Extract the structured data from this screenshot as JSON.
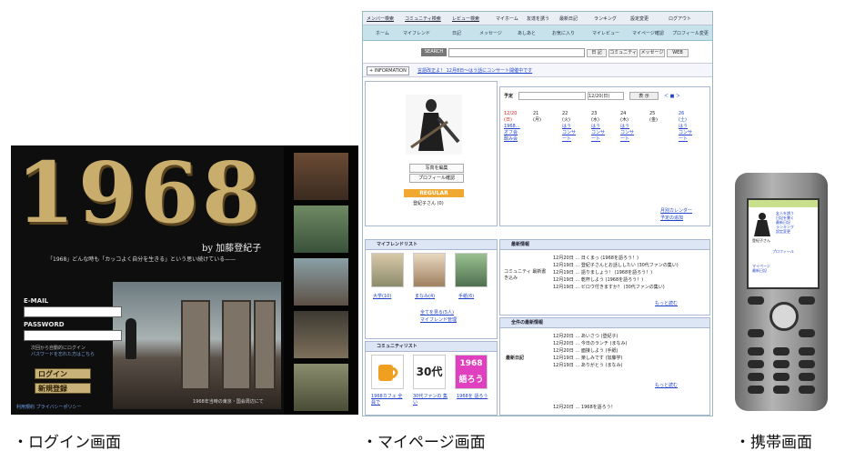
{
  "login_screen": {
    "logo_text": "1968",
    "author_credit": "by 加藤登紀子",
    "tagline": "「1968」どんな時も「カッコよく自分を生きる」という思い続けている——",
    "email_label": "E-MAIL",
    "password_label": "PASSWORD",
    "remember_hint": "次回から自動的にログイン",
    "forgot_link": "パスワードを忘れた方はこちら",
    "login_button": "ログイン",
    "register_button": "新規登録",
    "footer_link": "利用規約 プライバシーポリシー",
    "photo_caption": "1968年当時の東京・国会周辺にて"
  },
  "mypage_screen": {
    "topbar": [
      "メンバー検索",
      "コミュニティ検索",
      "レビュー検索",
      "マイホーム",
      "友達を誘う",
      "最新日記",
      "ランキング",
      "設定変更",
      "ログアウト"
    ],
    "nav": [
      "ホーム",
      "マイフレンド",
      "日記",
      "メッセージ",
      "あしあと",
      "お気に入り",
      "マイレビュー",
      "マイページ確認",
      "プロフィール変更"
    ],
    "search_button": "SEARCH",
    "search_options": [
      "日 記",
      "コミュニティ",
      "メッセージ",
      "WEB"
    ],
    "info_label": "+ INFORMATION",
    "info_text": "言語改正よ！ 12月8日〜はう話にコンサート開催中です",
    "profile_buttons": [
      "写真を編集",
      "プロフィール確認"
    ],
    "rank_badge": "REGULAR",
    "user_name": "登紀子さん (0)",
    "schedule": {
      "label": "予定",
      "date_select": "12/20(日)",
      "go_button": "表 示",
      "nav_links": "＜ ■ ＞",
      "days": [
        {
          "date": "12/20",
          "weekday": "(日)",
          "entries": [
            "1968…",
            "オフ会",
            "飲み会"
          ]
        },
        {
          "date": "21",
          "weekday": "(月)",
          "entries": []
        },
        {
          "date": "22",
          "weekday": "(火)",
          "entries": [
            "はう",
            "コンサ",
            "ート"
          ]
        },
        {
          "date": "23",
          "weekday": "(水)",
          "entries": [
            "はう",
            "コンサ",
            "ート"
          ]
        },
        {
          "date": "24",
          "weekday": "(木)",
          "entries": [
            "はう",
            "コンサ",
            "ート"
          ]
        },
        {
          "date": "25",
          "weekday": "(金)",
          "entries": []
        },
        {
          "date": "26",
          "weekday": "(土)",
          "entries": [
            "はう",
            "コンサ",
            "ート"
          ]
        }
      ],
      "links": [
        "月別カレンダー",
        "予定の追加"
      ]
    },
    "friends": {
      "title": "マイフレンドリスト",
      "items": [
        "大学(10)",
        "まなみ(4)",
        "手紙(6)"
      ],
      "links": [
        "全てを見る(5人)",
        "マイフレンド管理"
      ]
    },
    "latest": {
      "title": "最新情報",
      "label": "コミュニティ 最新書き込み",
      "lines": [
        "12月20日 … 日くまっ (1968を語ろう！)",
        "12月19日 … 登紀子さんとお話ししたい (30代ファンの集い)",
        "12月19日 … 語りましょう！ (1968を語ろう！)",
        "12月19日 … 乾杯しよう (1968を語ろう！)",
        "12月19日 … ビロウ付きますか？ (30代ファンの集い)"
      ],
      "more": "もっと読む"
    },
    "communities": {
      "title": "コミュニティリスト",
      "items": [
        "30代",
        "1968 語ろう"
      ],
      "labels": [
        "1968カフェ 全員で",
        "30代ファンの 集い",
        "1968を 語ろう"
      ]
    },
    "friend_updates": {
      "title": "全件の最新情報",
      "label": "最新日記",
      "lines": [
        "12月20日 … あいさつ (登紀子)",
        "12月20日 … 今日のランチ (まなみ)",
        "12月20日 … 面接しよう (手紙)",
        "12月19日 … 楽しみです (加藤学)",
        "12月19日 … ありがとう (まなみ)",
        "12月20日 … 1968を語ろう！"
      ],
      "more": "もっと読む"
    }
  },
  "phone_screen": {
    "menu": [
      "友人を誘う",
      "日記を書く",
      "最新日記",
      "ランキング",
      "設定変更"
    ],
    "user": "登紀子さん",
    "profile_link": "プロフィール",
    "bottom_links": [
      "マイページ",
      "最新日記"
    ]
  },
  "captions": {
    "login": "・ログイン画面",
    "mypage": "・マイページ画面",
    "mobile": "・携帯画面"
  }
}
